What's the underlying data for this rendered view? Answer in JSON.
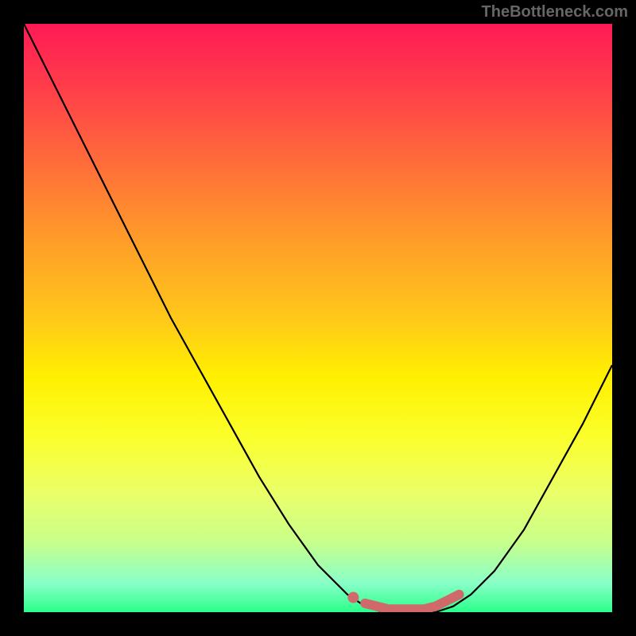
{
  "watermark": "TheBottleneck.com",
  "chart_data": {
    "type": "line",
    "title": "",
    "xlabel": "",
    "ylabel": "",
    "xlim": [
      0,
      1
    ],
    "ylim": [
      0,
      1
    ],
    "x": [
      0.0,
      0.05,
      0.1,
      0.15,
      0.2,
      0.25,
      0.3,
      0.35,
      0.4,
      0.45,
      0.5,
      0.55,
      0.58,
      0.61,
      0.64,
      0.67,
      0.7,
      0.73,
      0.76,
      0.8,
      0.85,
      0.9,
      0.95,
      1.0
    ],
    "values": [
      1.0,
      0.9,
      0.8,
      0.7,
      0.6,
      0.5,
      0.41,
      0.32,
      0.23,
      0.15,
      0.08,
      0.03,
      0.01,
      0.0,
      0.0,
      0.0,
      0.0,
      0.01,
      0.03,
      0.07,
      0.14,
      0.23,
      0.32,
      0.42
    ],
    "highlight": {
      "color": "#d06a6a",
      "x": [
        0.56,
        0.58,
        0.6,
        0.62,
        0.64,
        0.66,
        0.68,
        0.7,
        0.72,
        0.74
      ],
      "values": [
        0.025,
        0.015,
        0.01,
        0.005,
        0.005,
        0.005,
        0.005,
        0.01,
        0.02,
        0.03
      ]
    },
    "background_gradient": {
      "top": "#ff1a55",
      "middle": "#fff000",
      "bottom": "#2aff8a"
    }
  }
}
